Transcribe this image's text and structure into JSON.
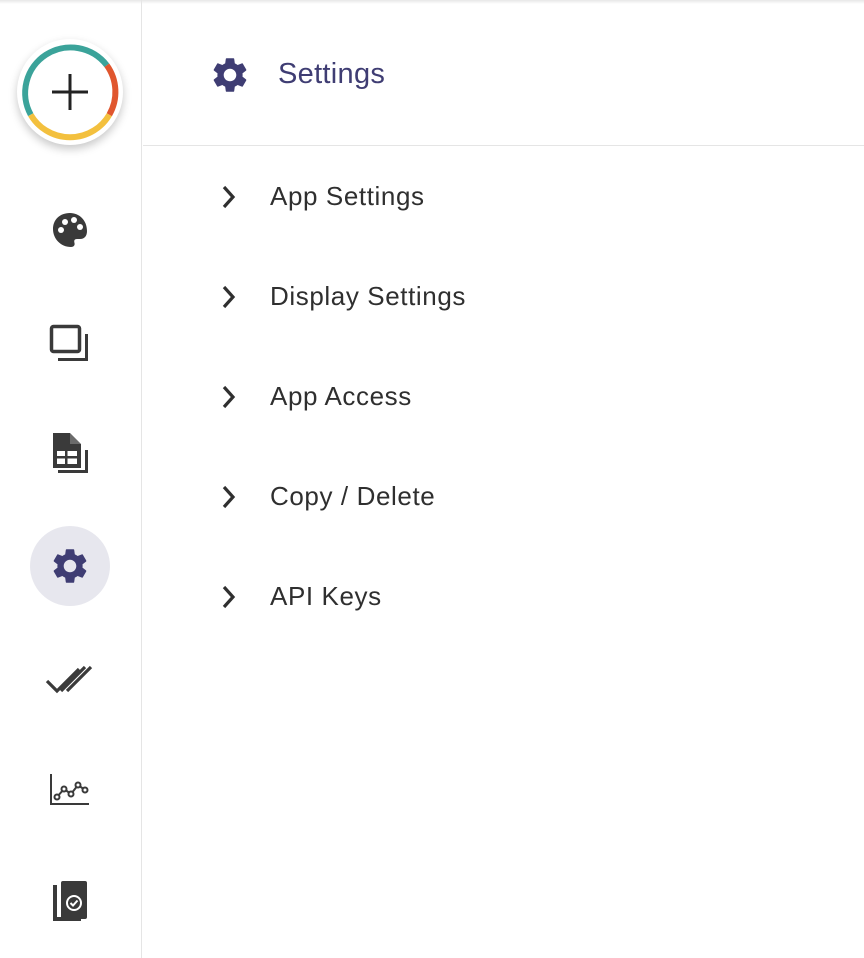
{
  "header": {
    "title": "Settings",
    "icon": "gear-icon"
  },
  "menu": [
    {
      "label": "App Settings"
    },
    {
      "label": "Display Settings"
    },
    {
      "label": "App Access"
    },
    {
      "label": "Copy / Delete"
    },
    {
      "label": "API Keys"
    }
  ],
  "sidebar": {
    "fab_icon": "plus-icon",
    "items": [
      {
        "icon": "palette-icon"
      },
      {
        "icon": "windows-icon"
      },
      {
        "icon": "spreadsheet-icon"
      },
      {
        "icon": "gear-icon",
        "active": true
      },
      {
        "icon": "double-check-icon"
      },
      {
        "icon": "line-chart-icon"
      },
      {
        "icon": "copy-check-icon"
      }
    ]
  },
  "colors": {
    "accent": "#3f3d73",
    "icon_gray": "#3a3a3a",
    "active_bg": "#e7e7ee",
    "fab_ring": [
      "#3ba39a",
      "#e0562e",
      "#f3c03e"
    ]
  }
}
